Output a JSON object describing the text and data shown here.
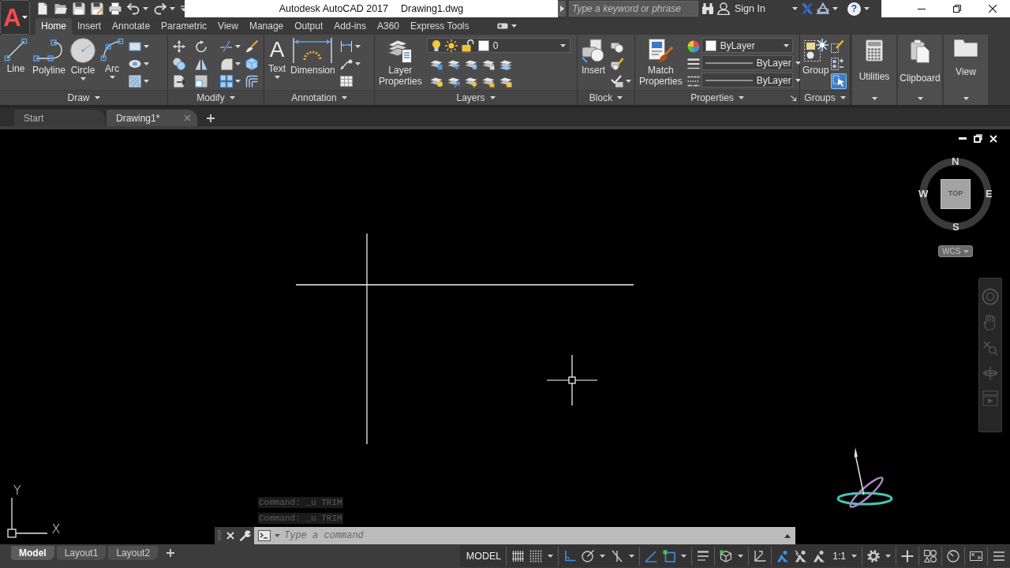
{
  "app_menu": {
    "glyph": "A"
  },
  "window": {
    "app_title": "Autodesk AutoCAD 2017",
    "file_name": "Drawing1.dwg",
    "search": {
      "placeholder": "Type a keyword or phrase"
    },
    "sign_in": "Sign In",
    "help_glyph": "?"
  },
  "ribbon": {
    "tabs": [
      {
        "label": "Home",
        "selected": true
      },
      {
        "label": "Insert",
        "selected": false
      },
      {
        "label": "Annotate",
        "selected": false
      },
      {
        "label": "Parametric",
        "selected": false
      },
      {
        "label": "View",
        "selected": false
      },
      {
        "label": "Manage",
        "selected": false
      },
      {
        "label": "Output",
        "selected": false
      },
      {
        "label": "Add-ins",
        "selected": false
      },
      {
        "label": "A360",
        "selected": false
      },
      {
        "label": "Express Tools",
        "selected": false
      }
    ],
    "panels": [
      {
        "kind": "draw",
        "title": "Draw",
        "tools": [
          {
            "label": "Line",
            "dropdown": false
          },
          {
            "label": "Polyline",
            "dropdown": false
          },
          {
            "label": "Circle",
            "dropdown": true
          },
          {
            "label": "Arc",
            "dropdown": true
          }
        ]
      },
      {
        "kind": "modify",
        "title": "Modify"
      },
      {
        "kind": "annotation",
        "title": "Annotation",
        "tools": [
          {
            "label": "Text",
            "glyph": "A",
            "dropdown": true
          },
          {
            "label": "Dimension",
            "dropdown": false
          }
        ]
      },
      {
        "kind": "layers",
        "title": "Layers",
        "tools": [
          {
            "label": "Layer Properties",
            "dropdown": false
          }
        ],
        "current_layer": "0"
      },
      {
        "kind": "block",
        "title": "Block",
        "tools": [
          {
            "label": "Insert",
            "dropdown": false
          }
        ]
      },
      {
        "kind": "properties",
        "title": "Properties",
        "tools": [
          {
            "label": "Match Properties",
            "dropdown": false
          }
        ],
        "dropdowns": [
          {
            "kind": "color",
            "value": "ByLayer"
          },
          {
            "kind": "linetype",
            "value": "ByLayer"
          },
          {
            "kind": "lineweight",
            "value": "ByLayer"
          }
        ]
      },
      {
        "kind": "groups",
        "title": "Groups",
        "tools": [
          {
            "label": "Group",
            "dropdown": false
          }
        ],
        "selection_toggle": {
          "on": true
        }
      },
      {
        "kind": "collapsed",
        "title": "Utilities"
      },
      {
        "kind": "collapsed",
        "title": "Clipboard"
      },
      {
        "kind": "collapsed",
        "title": "View"
      }
    ]
  },
  "file_tabs": [
    {
      "label": "Start",
      "selected": false,
      "closable": false
    },
    {
      "label": "Drawing1*",
      "selected": true,
      "closable": true
    }
  ],
  "viewcube": {
    "north": "N",
    "east": "E",
    "south": "S",
    "west": "W",
    "face": "TOP",
    "ucs_menu": "WCS"
  },
  "ucs_icon": {
    "x_label": "X",
    "y_label": "Y"
  },
  "command_history": [
    "Command: _u TRIM",
    "Command: _u TRIM"
  ],
  "command_line": {
    "placeholder": "Type a command"
  },
  "layout_tabs": [
    {
      "label": "Model",
      "selected": true
    },
    {
      "label": "Layout1",
      "selected": false
    },
    {
      "label": "Layout2",
      "selected": false
    }
  ],
  "status_bar": {
    "space": "MODEL",
    "toggles": [
      {
        "on": false
      },
      {
        "on": false
      },
      {
        "on": true
      },
      {
        "on": false
      },
      {
        "on": false
      },
      {
        "on": true
      },
      {
        "on": true
      },
      {
        "on": false
      },
      {
        "on": false
      },
      {
        "on": false
      },
      {
        "on": true
      },
      {
        "on": false
      }
    ],
    "annotation_scale": "1:1"
  }
}
